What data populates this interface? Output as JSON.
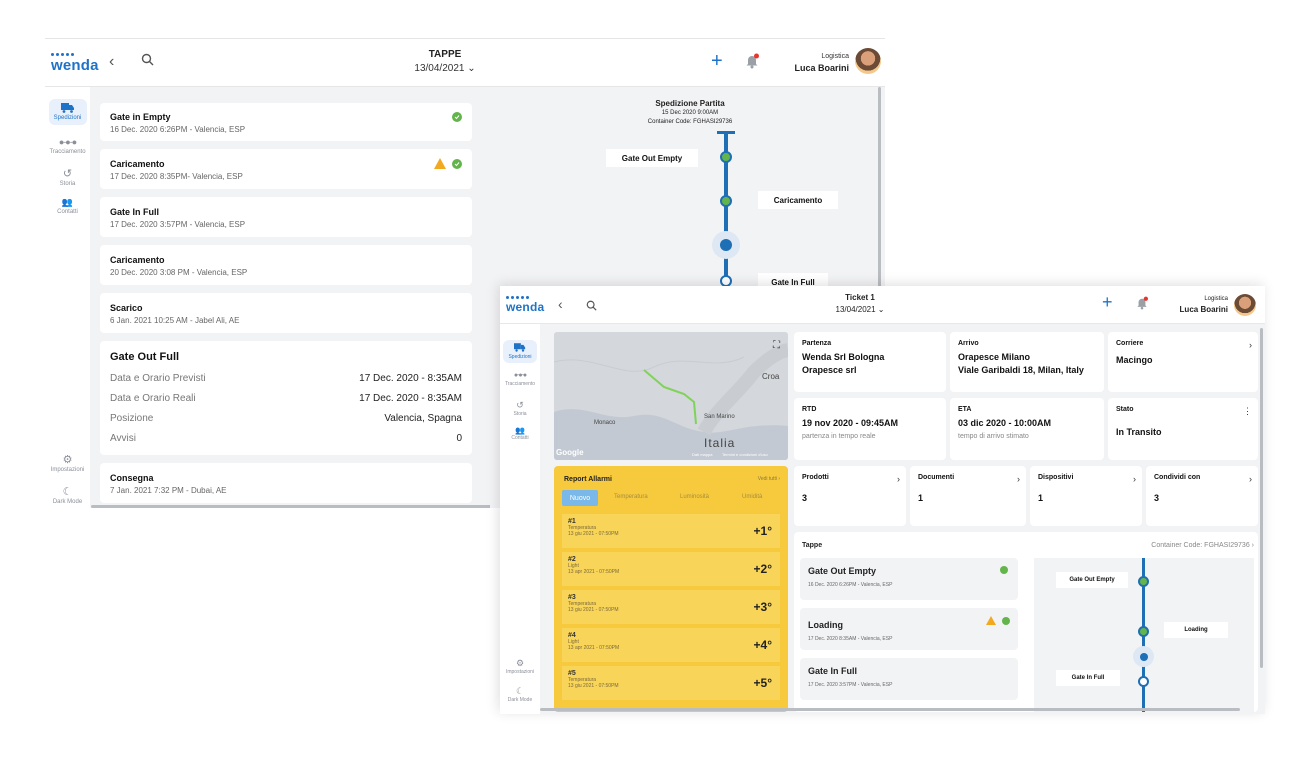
{
  "logo": "wenda",
  "window1": {
    "title": "TAPPE",
    "date": "13/04/2021 ⌄",
    "user": {
      "role": "Logistica",
      "name": "Luca Boarini"
    },
    "sidebar": [
      {
        "label": "Spedizioni",
        "icon": "truck-icon",
        "active": true
      },
      {
        "label": "Tracciamento",
        "icon": "route-icon"
      },
      {
        "label": "Storia",
        "icon": "history-icon"
      },
      {
        "label": "Contatti",
        "icon": "contacts-icon"
      },
      {
        "label": "Impostazioni",
        "icon": "gear-icon"
      },
      {
        "label": "Dark Mode",
        "icon": "moon-icon"
      }
    ],
    "steps": [
      {
        "title": "Gate in Empty",
        "sub": "16 Dec. 2020 6:26PM - Valencia, ESP",
        "status": "ok"
      },
      {
        "title": "Caricamento",
        "sub": "17 Dec. 2020 8:35PM- Valencia, ESP",
        "status": "warn"
      },
      {
        "title": "Gate In Full",
        "sub": "17 Dec. 2020 3:57PM - Valencia, ESP",
        "status": ""
      },
      {
        "title": "Caricamento",
        "sub": "20 Dec. 2020 3:08 PM - Valencia, ESP",
        "status": ""
      },
      {
        "title": "Scarico",
        "sub": "6 Jan. 2021 10:25 AM - Jabel Ali, AE",
        "status": ""
      }
    ],
    "expanded": {
      "title": "Gate Out Full",
      "rows": [
        {
          "k": "Data e Orario Previsti",
          "v": "17 Dec. 2020 - 8:35AM"
        },
        {
          "k": "Data e Orario Reali",
          "v": "17 Dec. 2020 - 8:35AM"
        },
        {
          "k": "Posizione",
          "v": "Valencia, Spagna"
        },
        {
          "k": "Avvisi",
          "v": "0"
        }
      ]
    },
    "last_step": {
      "title": "Consegna",
      "sub": "7 Jan. 2021 7:32 PM - Dubai, AE"
    },
    "timeline": {
      "header": "Spedizione Partita",
      "date": "15 Dec 2020 9:00AM",
      "container": "Container Code: FGHASI29736",
      "labels": [
        "Gate Out Empty",
        "Caricamento",
        "Gate In Full"
      ]
    }
  },
  "window2": {
    "title": "Ticket 1",
    "date": "13/04/2021 ⌄",
    "user": {
      "role": "Logistica",
      "name": "Luca Boarini"
    },
    "sidebar": [
      {
        "label": "Spedizioni",
        "icon": "truck-icon",
        "active": true
      },
      {
        "label": "Tracciamento",
        "icon": "route-icon"
      },
      {
        "label": "Storia",
        "icon": "history-icon"
      },
      {
        "label": "Contatti",
        "icon": "contacts-icon"
      },
      {
        "label": "Impostazioni",
        "icon": "gear-icon"
      },
      {
        "label": "Dark Mode",
        "icon": "moon-icon"
      }
    ],
    "map": {
      "labels": [
        "Monaco",
        "San Marino",
        "Italia",
        "Croa"
      ],
      "google": "Google",
      "attribution_a": "Dati mappa",
      "attribution_b": "Termini e condizioni d'uso"
    },
    "partenza": {
      "label": "Partenza",
      "line1": "Wenda Srl Bologna",
      "line2": "Orapesce srl"
    },
    "arrivo": {
      "label": "Arrivo",
      "line1": "Orapesce Milano",
      "line2": "Viale Garibaldi 18, Milan, Italy"
    },
    "corriere": {
      "label": "Corriere",
      "value": "Macingo"
    },
    "rtd": {
      "label": "RTD",
      "value": "19 nov 2020 - 09:45AM",
      "note": "partenza in tempo reale"
    },
    "eta": {
      "label": "ETA",
      "value": "03 dic 2020 - 10:00AM",
      "note": "tempo di arrivo stimato"
    },
    "stato": {
      "label": "Stato",
      "value": "In Transito"
    },
    "counters": [
      {
        "label": "Prodotti",
        "value": "3"
      },
      {
        "label": "Documenti",
        "value": "1"
      },
      {
        "label": "Dispositivi",
        "value": "1"
      },
      {
        "label": "Condividi con",
        "value": "3"
      }
    ],
    "alarms": {
      "title": "Report Allarmi",
      "link": "Vedi tutti ›",
      "tabs": [
        "Nuovo",
        "Temperatura",
        "Luminosità",
        "Umidità"
      ],
      "items": [
        {
          "id": "#1",
          "kind": "Temperatura",
          "date": "13 giu 2021 - 07:50PM",
          "value": "+1°"
        },
        {
          "id": "#2",
          "kind": "Light",
          "date": "13 apr 2021 - 07:50PM",
          "value": "+2°"
        },
        {
          "id": "#3",
          "kind": "Temperatura",
          "date": "13 giu 2021 - 07:50PM",
          "value": "+3°"
        },
        {
          "id": "#4",
          "kind": "Light",
          "date": "13 apr 2021 - 07:50PM",
          "value": "+4°"
        },
        {
          "id": "#5",
          "kind": "Temperatura",
          "date": "13 giu 2021 - 07:50PM",
          "value": "+5°"
        }
      ]
    },
    "tappe": {
      "title": "Tappe",
      "container": "Container Code: FGHASI29736 ›",
      "steps": [
        {
          "title": "Gate Out Empty",
          "sub": "16 Dec. 2020 6:26PM - Valencia, ESP",
          "status": "ok"
        },
        {
          "title": "Loading",
          "sub": "17 Dec. 2020 8:35AM - Valencia, ESP",
          "status": "warn"
        },
        {
          "title": "Gate In Full",
          "sub": "17 Dec. 2020 3:57PM - Valencia, ESP",
          "status": ""
        }
      ],
      "timeline_labels": [
        "Gate Out Empty",
        "Loading",
        "Gate In Full"
      ]
    }
  },
  "colors": {
    "brand": "#1e73c8",
    "ok": "#63b44b",
    "warn": "#f3a91f",
    "alarm": "#f7c93c",
    "notify": "#e8362d"
  }
}
